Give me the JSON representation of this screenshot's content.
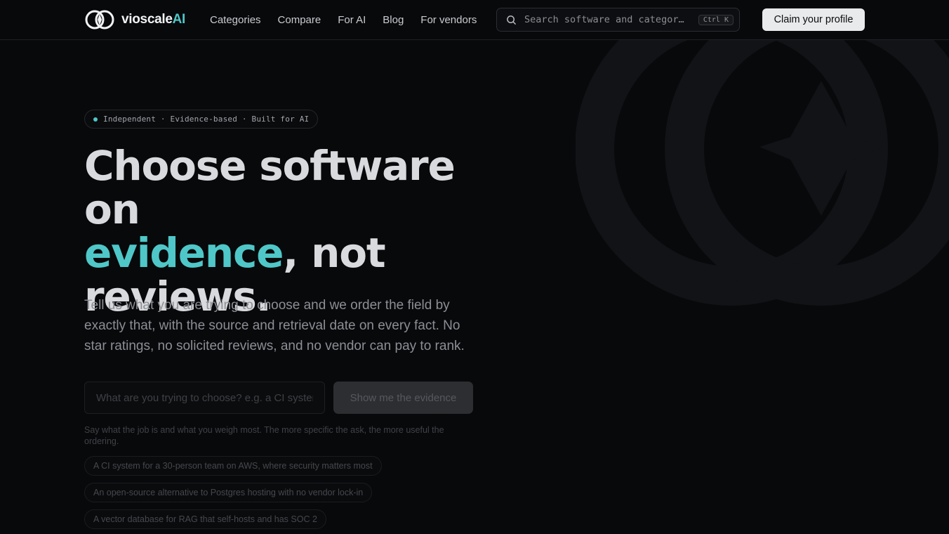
{
  "header": {
    "brand_name": "vioscale",
    "brand_suffix": "AI",
    "nav": [
      {
        "label": "Categories"
      },
      {
        "label": "Compare"
      },
      {
        "label": "For AI"
      },
      {
        "label": "Blog"
      },
      {
        "label": "For vendors"
      }
    ],
    "search": {
      "placeholder": "Search software and categor…",
      "shortcut": "Ctrl K",
      "icon": "search-icon"
    },
    "claim_label": "Claim your profile"
  },
  "hero": {
    "pill_text": "Independent · Evidence-based · Built for AI",
    "headline_line1": "Choose software on",
    "headline_accent": "evidence",
    "headline_after_accent": ", not",
    "headline_line3": "reviews.",
    "lede": "Tell us what you are trying to choose and we order the field by exactly that, with the source and retrieval date on every fact. No star ratings, no solicited reviews, and no vendor can pay to rank.",
    "ask_placeholder": "What are you trying to choose? e.g. a CI system",
    "ask_button": "Show me the evidence",
    "hint": "Say what the job is and what you weigh most. The more specific the ask, the more useful the ordering.",
    "examples": [
      {
        "label": "A CI system for a 30-person team on AWS, where security matters most"
      },
      {
        "label": "An open-source alternative to Postgres hosting with no vendor lock-in"
      },
      {
        "label": "A vector database for RAG that self-hosts and has SOC 2"
      }
    ]
  },
  "colors": {
    "background": "#08090b",
    "accent": "#4fc7c8",
    "button_light": "#e9eaec"
  }
}
